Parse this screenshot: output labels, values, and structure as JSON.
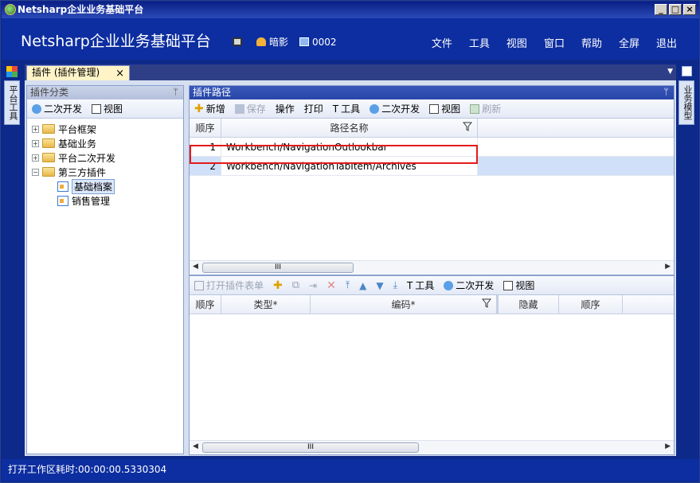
{
  "window": {
    "title": "Netsharp企业业务基础平台",
    "controls": [
      "_",
      "□",
      "×"
    ]
  },
  "header": {
    "brand": "Netsharp企业业务基础平台",
    "user_name": "暗影",
    "station": "0002",
    "menu": [
      "文件",
      "工具",
      "视图",
      "窗口",
      "帮助",
      "全屏",
      "退出"
    ]
  },
  "side_tabs": {
    "left": "平台工具",
    "right": "业务模型"
  },
  "doc_tab": {
    "label": "插件 (插件管理)",
    "close": "×"
  },
  "left_panel": {
    "title": "插件分类",
    "toolbar": [
      "二次开发",
      "视图"
    ],
    "tree": [
      {
        "label": "平台框架",
        "expander": "+",
        "type": "folder",
        "level": 0
      },
      {
        "label": "基础业务",
        "expander": "+",
        "type": "folder",
        "level": 0
      },
      {
        "label": "平台二次开发",
        "expander": "+",
        "type": "folder",
        "level": 0
      },
      {
        "label": "第三方插件",
        "expander": "−",
        "type": "folder",
        "level": 0
      },
      {
        "label": "基础档案",
        "expander": "",
        "type": "leaf",
        "level": 1,
        "selected": true
      },
      {
        "label": "销售管理",
        "expander": "",
        "type": "leaf",
        "level": 1
      }
    ]
  },
  "path_panel": {
    "title": "插件路径",
    "toolbar": {
      "add": "新增",
      "save": "保存",
      "operate": "操作",
      "print": "打印",
      "tools": "工具",
      "dev": "二次开发",
      "view": "视图",
      "refresh": "刷新"
    },
    "columns": {
      "order": "顺序",
      "path": "路径名称"
    },
    "rows": [
      {
        "order": "1",
        "path": "Workbench/NavigationOutlookbar"
      },
      {
        "order": "2",
        "path": "Workbench/NavigationTabItem/Archives"
      }
    ],
    "scroll_thumb": "III"
  },
  "form_panel": {
    "toolbar": {
      "open_form": "打开插件表单",
      "tools": "工具",
      "dev": "二次开发",
      "view": "视图"
    },
    "columns": {
      "order": "顺序",
      "type": "类型*",
      "code": "编码*",
      "hidden": "隐藏",
      "order2": "顺序"
    },
    "scroll_thumb": "III"
  },
  "status": {
    "text": "打开工作区耗时:00:00:00.5330304"
  },
  "colors": {
    "brand_blue": "#0d2ea0",
    "highlight_box": "#e31b1b"
  }
}
